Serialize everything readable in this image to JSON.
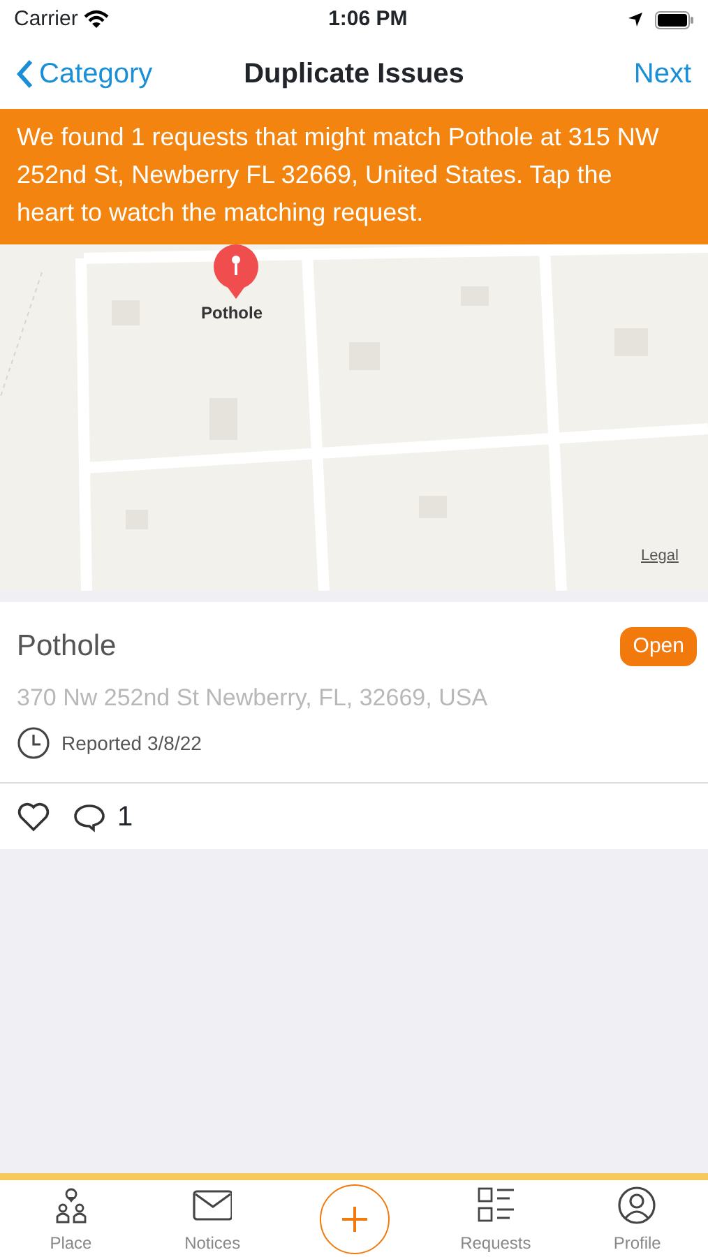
{
  "status_bar": {
    "carrier": "Carrier",
    "time": "1:06 PM"
  },
  "nav": {
    "back": "Category",
    "title": "Duplicate Issues",
    "action": "Next"
  },
  "banner": "We found 1 requests that might match Pothole at 315 NW 252nd St, Newberry FL 32669, United States. Tap the heart to watch the matching request.",
  "map": {
    "kind": "picture",
    "pin_label": "Pothole",
    "legal": "Legal"
  },
  "issue": {
    "title": "Pothole",
    "status": "Open",
    "address": "370 Nw 252nd St Newberry, FL, 32669, USA",
    "reported": "Reported 3/8/22",
    "watched": false,
    "comments": "1"
  },
  "tabs": [
    {
      "kind": "place",
      "label": "Place"
    },
    {
      "kind": "notices",
      "label": "Notices"
    },
    {
      "kind": "add"
    },
    {
      "kind": "requests",
      "label": "Requests"
    },
    {
      "kind": "profile",
      "label": "Profile"
    }
  ]
}
